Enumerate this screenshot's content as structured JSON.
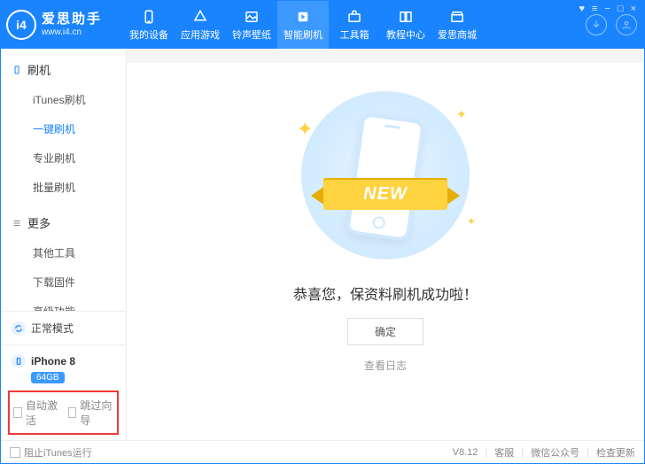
{
  "brand": {
    "logo_text": "i4",
    "title": "爱思助手",
    "url": "www.i4.cn"
  },
  "nav": {
    "items": [
      {
        "label": "我的设备"
      },
      {
        "label": "应用游戏"
      },
      {
        "label": "铃声壁纸"
      },
      {
        "label": "智能刷机"
      },
      {
        "label": "工具箱"
      },
      {
        "label": "教程中心"
      },
      {
        "label": "爱思商城"
      }
    ]
  },
  "sidebar": {
    "sections": [
      {
        "title": "刷机",
        "items": [
          {
            "label": "iTunes刷机"
          },
          {
            "label": "一键刷机"
          },
          {
            "label": "专业刷机"
          },
          {
            "label": "批量刷机"
          }
        ]
      },
      {
        "title": "更多",
        "items": [
          {
            "label": "其他工具"
          },
          {
            "label": "下载固件"
          },
          {
            "label": "高级功能"
          }
        ]
      }
    ],
    "status_label": "正常模式",
    "device_name": "iPhone 8",
    "device_storage": "64GB",
    "checks": {
      "auto_activate": "自动激活",
      "skip_setup": "跳过向导"
    }
  },
  "hero": {
    "ribbon": "NEW",
    "success": "恭喜您，保资料刷机成功啦！",
    "ok": "确定",
    "view_log": "查看日志"
  },
  "footer": {
    "block_itunes": "阻止iTunes运行",
    "version": "V8.12",
    "support": "客服",
    "wechat": "微信公众号",
    "update": "检查更新"
  }
}
